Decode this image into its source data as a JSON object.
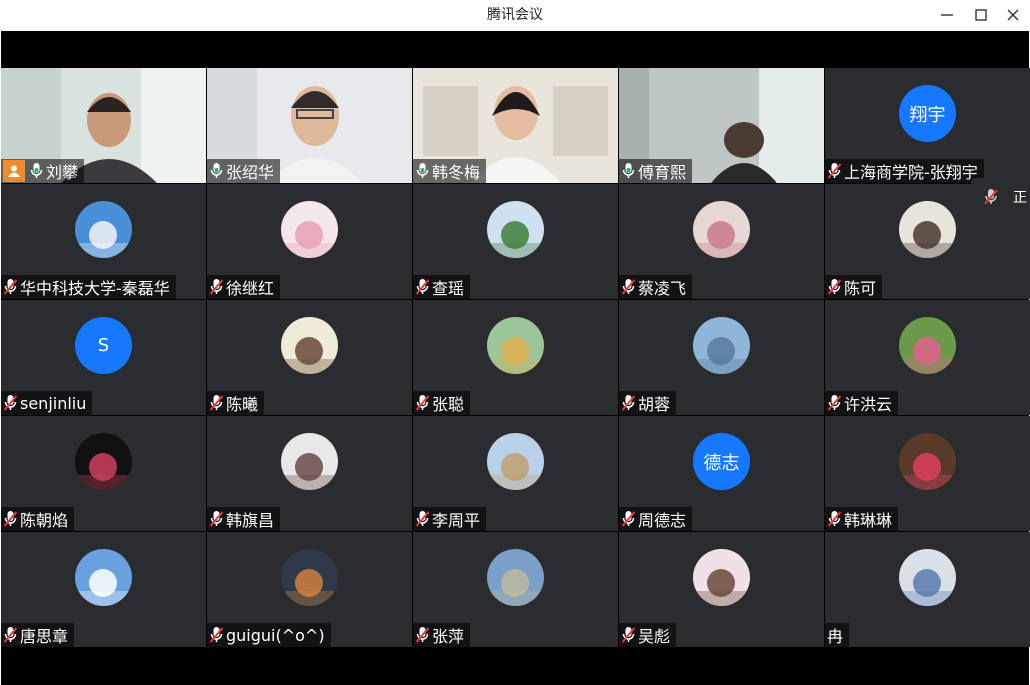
{
  "window": {
    "title": "腾讯会议"
  },
  "tiles": [
    {
      "name": "刘攀",
      "mic": "on",
      "type": "video",
      "host": true,
      "active": true
    },
    {
      "name": "张绍华",
      "mic": "on",
      "type": "video"
    },
    {
      "name": "韩冬梅",
      "mic": "on",
      "type": "video"
    },
    {
      "name": "傅育熙",
      "mic": "on",
      "type": "video"
    },
    {
      "name": "上海商学院-张翔宇",
      "mic": "off",
      "type": "text",
      "avatar_text": "翔宇"
    },
    {
      "name": "华中科技大学-秦磊华",
      "mic": "off",
      "type": "photo"
    },
    {
      "name": "徐继红",
      "mic": "off",
      "type": "photo"
    },
    {
      "name": "查瑶",
      "mic": "off",
      "type": "photo"
    },
    {
      "name": "蔡凌飞",
      "mic": "off",
      "type": "photo"
    },
    {
      "name": "陈可",
      "mic": "off",
      "type": "photo"
    },
    {
      "name": "senjinliu",
      "mic": "off",
      "type": "text",
      "avatar_text": "S"
    },
    {
      "name": "陈曦",
      "mic": "off",
      "type": "photo"
    },
    {
      "name": "张聪",
      "mic": "off",
      "type": "photo"
    },
    {
      "name": "胡蓉",
      "mic": "off",
      "type": "photo"
    },
    {
      "name": "许洪云",
      "mic": "off",
      "type": "photo"
    },
    {
      "name": "陈朝焰",
      "mic": "off",
      "type": "photo"
    },
    {
      "name": "韩旗昌",
      "mic": "off",
      "type": "photo"
    },
    {
      "name": "李周平",
      "mic": "off",
      "type": "photo"
    },
    {
      "name": "周德志",
      "mic": "off",
      "type": "text",
      "avatar_text": "德志"
    },
    {
      "name": "韩琳琳",
      "mic": "off",
      "type": "photo"
    },
    {
      "name": "唐思章",
      "mic": "off",
      "type": "photo"
    },
    {
      "name": "guigui(^o^)",
      "mic": "off",
      "type": "photo"
    },
    {
      "name": "张萍",
      "mic": "off",
      "type": "photo"
    },
    {
      "name": "吴彪",
      "mic": "off",
      "type": "photo"
    },
    {
      "name": "冉",
      "mic": "none",
      "type": "photo"
    }
  ],
  "side_popup": {
    "label": "正"
  },
  "colors": {
    "accent": "#1677ff",
    "active_border": "#33b35c",
    "host_badge": "#f28a2e",
    "tile_bg": "#2b2c2f",
    "mic_on": "#33b35c",
    "mic_off": "#e53935"
  }
}
